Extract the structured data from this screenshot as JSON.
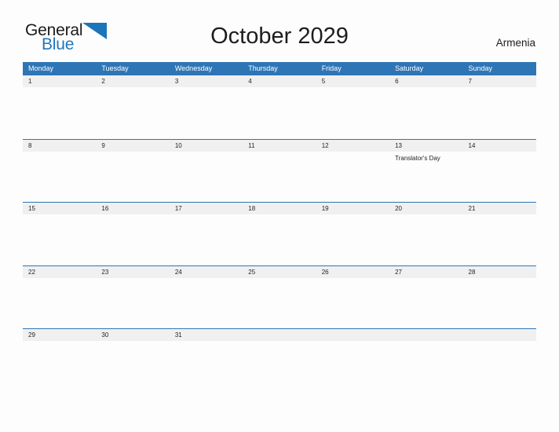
{
  "brand": {
    "name_part1": "General",
    "name_part2": "Blue",
    "flag_icon": "triangle-flag-icon",
    "color_primary": "#1b75bb",
    "color_text": "#1a1a1a"
  },
  "header": {
    "title": "October 2029",
    "country": "Armenia"
  },
  "calendar": {
    "header_color": "#2e75b6",
    "daynum_band_color": "#f0f0f0",
    "weekdays": [
      "Monday",
      "Tuesday",
      "Wednesday",
      "Thursday",
      "Friday",
      "Saturday",
      "Sunday"
    ],
    "weeks": [
      {
        "days": [
          {
            "num": "1",
            "events": []
          },
          {
            "num": "2",
            "events": []
          },
          {
            "num": "3",
            "events": []
          },
          {
            "num": "4",
            "events": []
          },
          {
            "num": "5",
            "events": []
          },
          {
            "num": "6",
            "events": []
          },
          {
            "num": "7",
            "events": []
          }
        ]
      },
      {
        "days": [
          {
            "num": "8",
            "events": []
          },
          {
            "num": "9",
            "events": []
          },
          {
            "num": "10",
            "events": []
          },
          {
            "num": "11",
            "events": []
          },
          {
            "num": "12",
            "events": []
          },
          {
            "num": "13",
            "events": [
              "Translator's Day"
            ]
          },
          {
            "num": "14",
            "events": []
          }
        ]
      },
      {
        "days": [
          {
            "num": "15",
            "events": []
          },
          {
            "num": "16",
            "events": []
          },
          {
            "num": "17",
            "events": []
          },
          {
            "num": "18",
            "events": []
          },
          {
            "num": "19",
            "events": []
          },
          {
            "num": "20",
            "events": []
          },
          {
            "num": "21",
            "events": []
          }
        ]
      },
      {
        "days": [
          {
            "num": "22",
            "events": []
          },
          {
            "num": "23",
            "events": []
          },
          {
            "num": "24",
            "events": []
          },
          {
            "num": "25",
            "events": []
          },
          {
            "num": "26",
            "events": []
          },
          {
            "num": "27",
            "events": []
          },
          {
            "num": "28",
            "events": []
          }
        ]
      },
      {
        "days": [
          {
            "num": "29",
            "events": []
          },
          {
            "num": "30",
            "events": []
          },
          {
            "num": "31",
            "events": []
          },
          {
            "num": "",
            "events": []
          },
          {
            "num": "",
            "events": []
          },
          {
            "num": "",
            "events": []
          },
          {
            "num": "",
            "events": []
          }
        ]
      }
    ]
  }
}
